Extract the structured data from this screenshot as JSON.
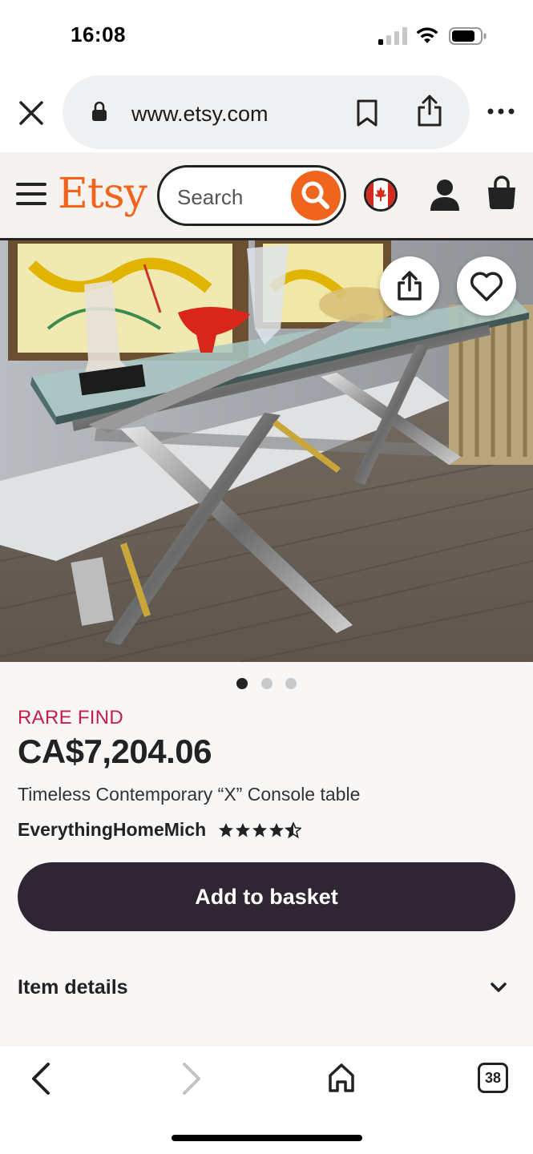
{
  "status_bar": {
    "time": "16:08"
  },
  "browser": {
    "url": "www.etsy.com",
    "tab_count": "38"
  },
  "header": {
    "logo": "Etsy",
    "search_placeholder": "Search"
  },
  "icons": {
    "close": "close-icon",
    "lock": "lock-icon",
    "bookmark": "bookmark-icon",
    "share": "share-icon",
    "more": "more-icon",
    "menu": "hamburger-icon",
    "search": "search-icon",
    "region": "canada-flag-icon",
    "account": "user-icon",
    "cart": "bag-icon",
    "favorite": "heart-icon",
    "back": "chevron-left-icon",
    "forward": "chevron-right-icon",
    "home": "home-icon",
    "expand": "chevron-down-icon"
  },
  "product": {
    "image_count": 3,
    "active_image": 1,
    "badge": "RARE FIND",
    "price": "CA$7,204.06",
    "title": "Timeless Contemporary “X” Console table",
    "seller": "EverythingHomeMich",
    "rating": 4.5,
    "add_to_basket_label": "Add to basket",
    "item_details_label": "Item details"
  },
  "colors": {
    "brand_orange": "#f1641e",
    "badge_red": "#c41e4a",
    "button_dark": "#2f2633",
    "page_bg": "#f8f7f5"
  }
}
